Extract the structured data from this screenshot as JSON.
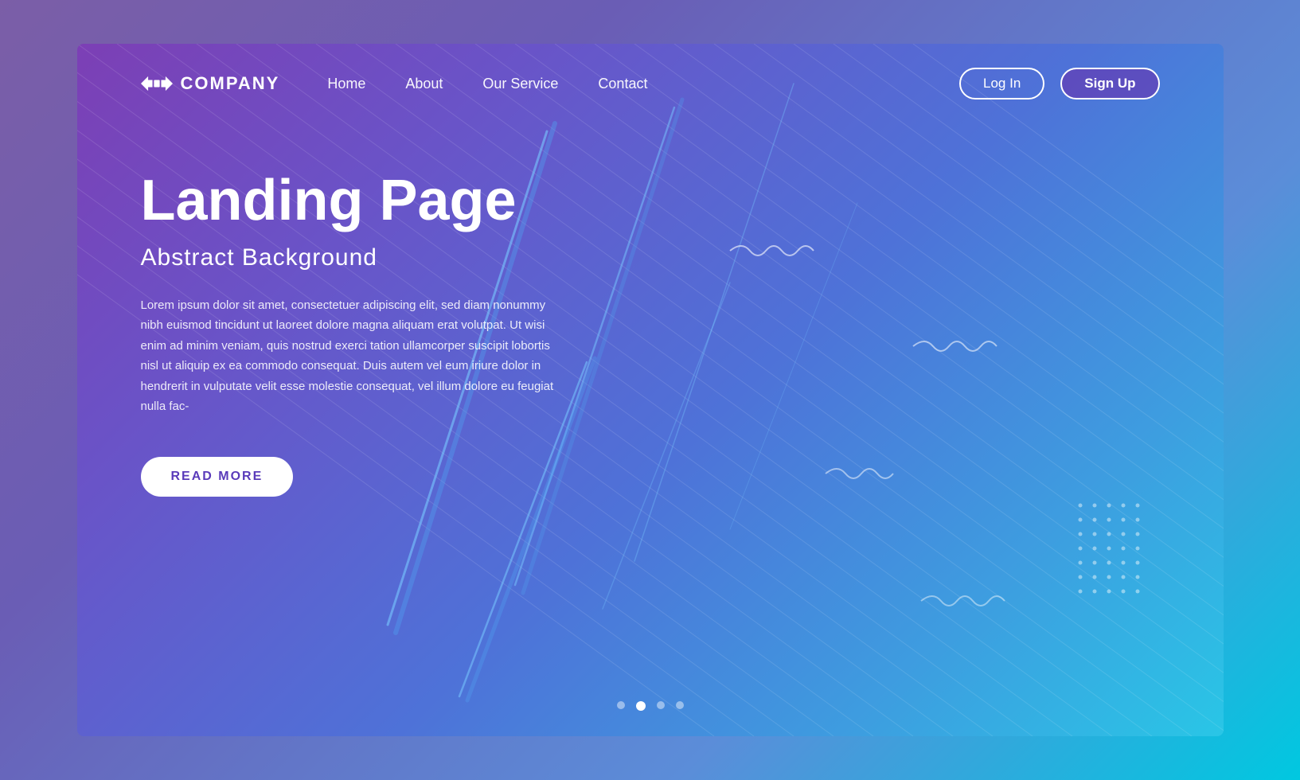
{
  "page": {
    "background_outer": "linear-gradient(135deg, #7b5ea7, #00c8e0)",
    "background_card": "linear-gradient(135deg, #7c3fb5, #3d9ee0)"
  },
  "navbar": {
    "logo_text": "COMPANY",
    "nav_items": [
      {
        "label": "Home",
        "id": "home"
      },
      {
        "label": "About",
        "id": "about"
      },
      {
        "label": "Our Service",
        "id": "service"
      },
      {
        "label": "Contact",
        "id": "contact"
      }
    ],
    "login_label": "Log In",
    "signup_label": "Sign Up"
  },
  "hero": {
    "title": "Landing Page",
    "subtitle": "Abstract Background",
    "body": "Lorem ipsum dolor sit amet, consectetuer adipiscing elit, sed diam nonummy nibh euismod tincidunt ut laoreet dolore magna aliquam erat volutpat. Ut wisi enim ad minim veniam, quis nostrud exerci tation ullamcorper suscipit lobortis nisl ut aliquip ex ea commodo consequat. Duis autem vel eum iriure dolor in hendrerit in vulputate velit esse molestie consequat, vel illum dolore eu feugiat nulla fac-",
    "read_more_label": "READ MORE"
  },
  "slides": {
    "total": 4,
    "active": 1,
    "dots": [
      "inactive",
      "active",
      "inactive",
      "inactive"
    ]
  }
}
